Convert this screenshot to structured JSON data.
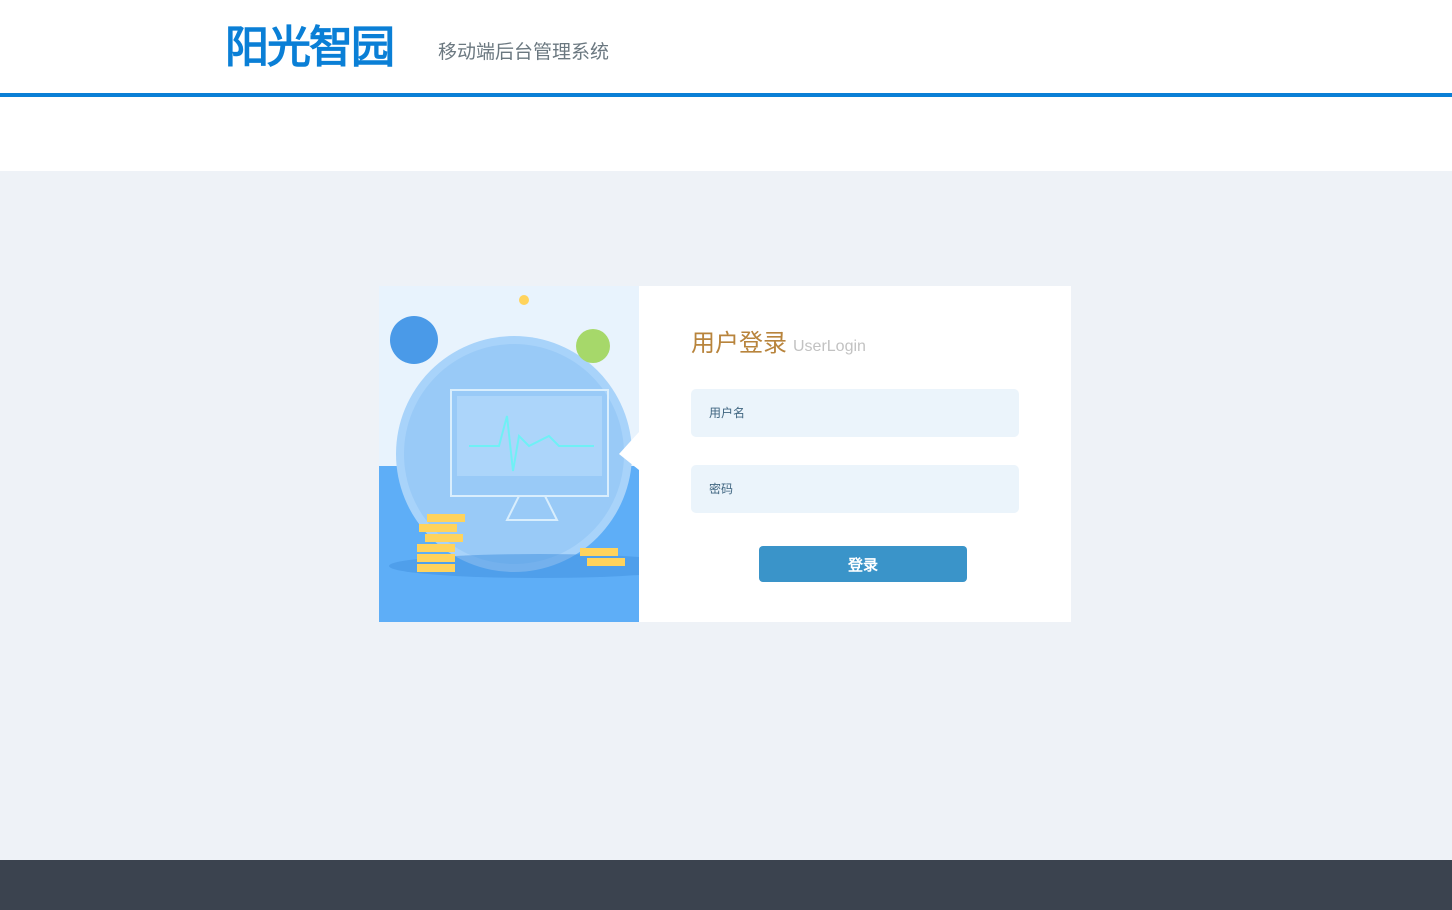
{
  "header": {
    "logo": "阳光智园",
    "subtitle": "移动端后台管理系统"
  },
  "login": {
    "title": "用户登录",
    "title_en": "UserLogin",
    "username_placeholder": "用户名",
    "password_placeholder": "密码",
    "submit_label": "登录"
  },
  "colors": {
    "brand": "#0a7fd6",
    "button": "#3a94c9",
    "title": "#b8843c",
    "footer": "#3b434f"
  }
}
